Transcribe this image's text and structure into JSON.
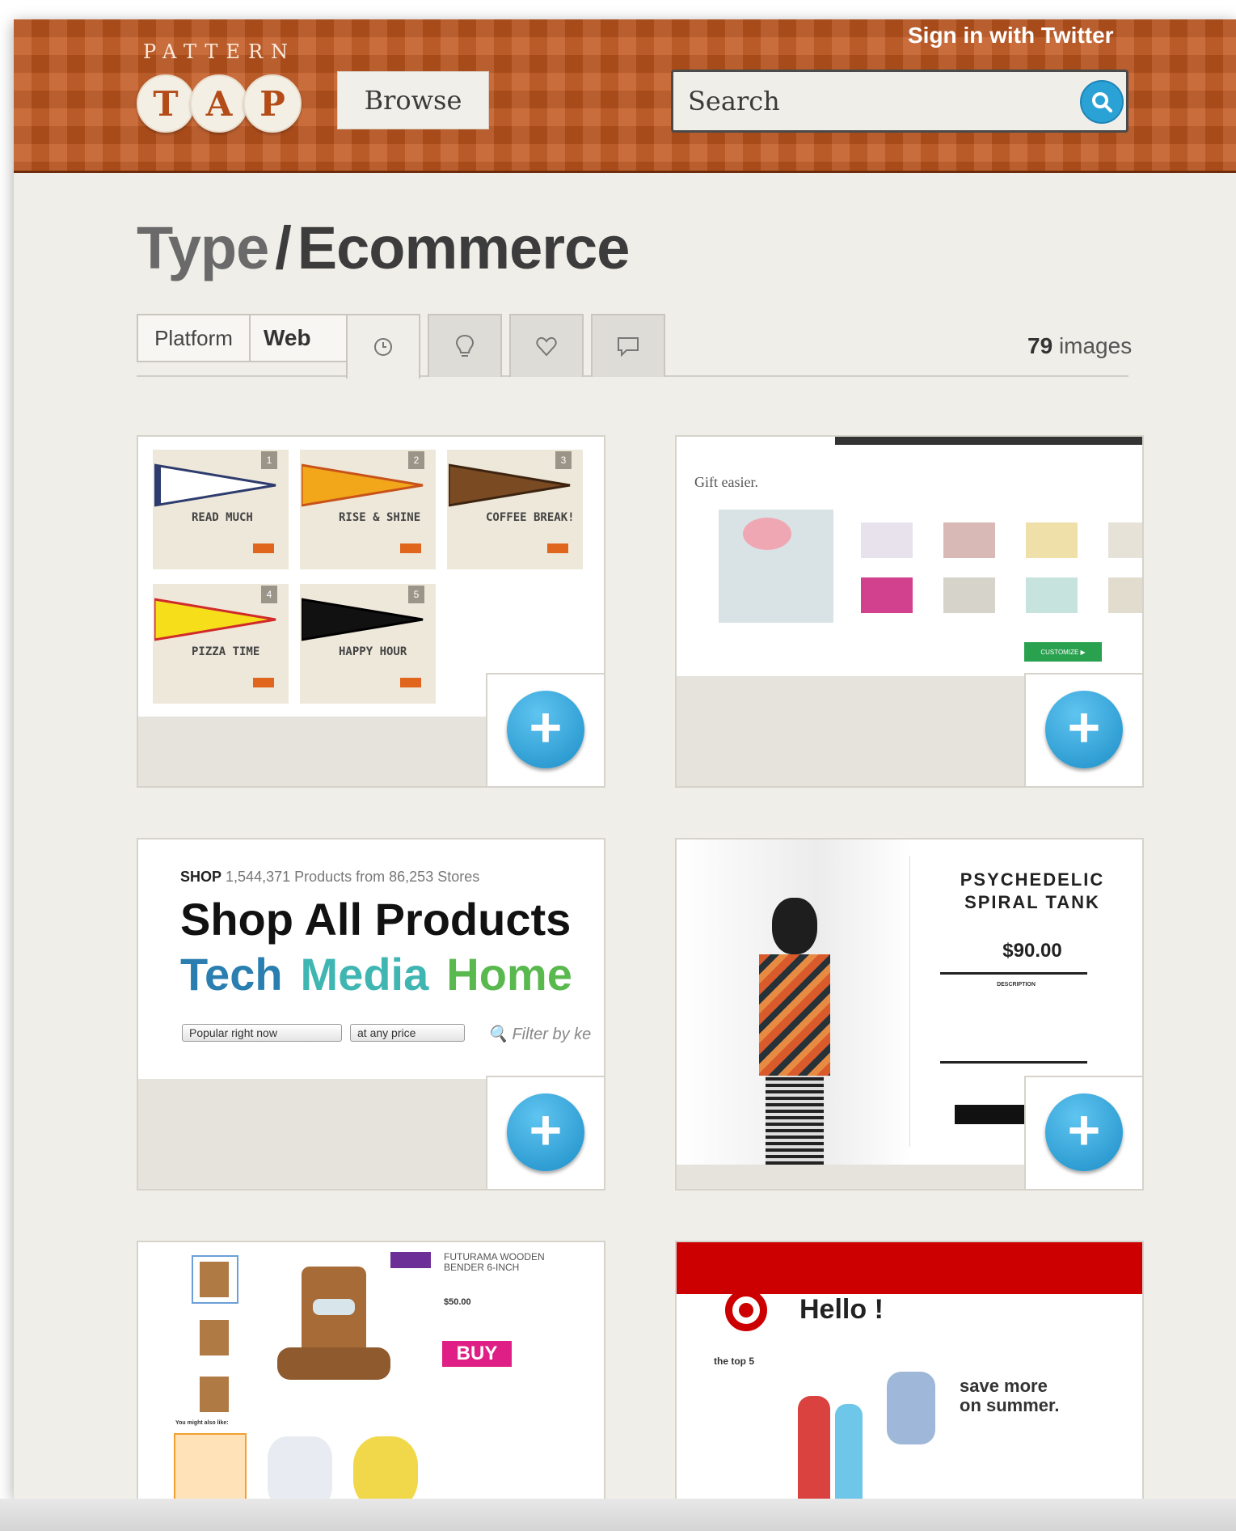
{
  "header": {
    "logo_top": "PATTERN",
    "logo_letters": [
      "T",
      "A",
      "P"
    ],
    "browse_label": "Browse",
    "signin_label": "Sign in with Twitter",
    "search_placeholder": "Search"
  },
  "page": {
    "title_type": "Type",
    "title_sep": "/",
    "title_category": "Ecommerce"
  },
  "filters": {
    "platform_label": "Platform",
    "platform_value": "Web",
    "tabs": [
      {
        "icon": "clock-icon",
        "active": true
      },
      {
        "icon": "lightbulb-icon",
        "active": false
      },
      {
        "icon": "heart-icon",
        "active": false
      },
      {
        "icon": "comment-icon",
        "active": false
      }
    ],
    "count_number": "79",
    "count_label": "images"
  },
  "cards": {
    "c1": {
      "pennants": [
        {
          "name": "READ MUCH",
          "num": "1"
        },
        {
          "name": "RISE & SHINE",
          "num": "2"
        },
        {
          "name": "COFFEE BREAK!",
          "num": "3"
        },
        {
          "name": "PIZZA TIME",
          "num": "4"
        },
        {
          "name": "HAPPY HOUR",
          "num": "5"
        }
      ]
    },
    "c2": {
      "headline": "Gift easier.",
      "button": "CUSTOMIZE ▶"
    },
    "c3": {
      "shop_label": "SHOP",
      "shop_stats": "1,544,371 Products from 86,253 Stores",
      "heading": "Shop All Products",
      "cat1": "Tech",
      "cat2": "Media",
      "cat3": "Home",
      "select1": "Popular right now",
      "select2": "at any price",
      "filter": "Filter by ke"
    },
    "c4": {
      "title": "PSYCHEDELIC SPIRAL TANK",
      "price": "$90.00",
      "desc_label": "DESCRIPTION"
    },
    "c5": {
      "product": "FUTURAMA WOODEN BENDER 6-INCH",
      "price": "$50.00",
      "buy": "BUY",
      "also": "You might also like:"
    },
    "c6": {
      "hello": "Hello !",
      "top5": "the top 5",
      "promo1": "save more",
      "promo2": "on summer."
    }
  },
  "colors": {
    "header_orange": "#c1571f",
    "add_blue": "#2ba2d6",
    "tech_blue": "#2a7fb0",
    "media_teal": "#3fb6b2",
    "home_green": "#5ab94e",
    "buy_pink": "#e01f86",
    "target_red": "#cc0000"
  }
}
